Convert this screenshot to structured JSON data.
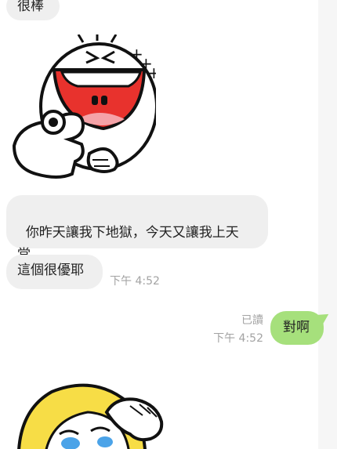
{
  "messages": [
    {
      "text": "很棒"
    },
    {
      "text": "你昨天讓我下地獄，今天又讓我上天\n堂"
    },
    {
      "text": "這個很優耶",
      "time": "下午 4:52"
    },
    {
      "text": "對啊",
      "read": "已讀",
      "time": "下午 4:52"
    }
  ],
  "stickers": [
    {
      "name": "moon-sticker-pointing"
    },
    {
      "name": "blonde-sticker-crying"
    }
  ],
  "colors": {
    "incoming_bubble": "#efefef",
    "outgoing_bubble": "#a6e07c",
    "timestamp": "#a3a3a3"
  }
}
